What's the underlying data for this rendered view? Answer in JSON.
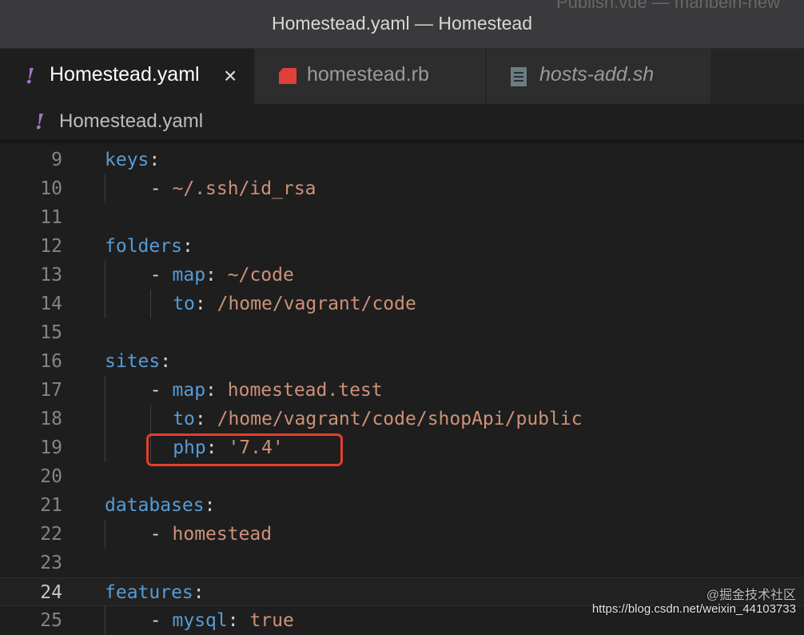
{
  "window": {
    "background_title": "Publish.vue — manbeln-new",
    "title": "Homestead.yaml — Homestead"
  },
  "tabs": [
    {
      "label": "Homestead.yaml",
      "icon": "yaml-icon",
      "active": true
    },
    {
      "label": "homestead.rb",
      "icon": "ruby-icon",
      "active": false
    },
    {
      "label": "hosts-add.sh",
      "icon": "shell-file-icon",
      "active": false
    }
  ],
  "breadcrumb": {
    "label": "Homestead.yaml",
    "icon": "yaml-icon"
  },
  "editor": {
    "current_line": "24",
    "lines": [
      {
        "n": "9",
        "k": "keys",
        "colon": ":",
        "dash": "",
        "val": ""
      },
      {
        "n": "10",
        "k": "",
        "colon": "",
        "dash": "- ",
        "val": "~/.ssh/id_rsa"
      },
      {
        "n": "11",
        "k": "",
        "colon": "",
        "dash": "",
        "val": ""
      },
      {
        "n": "12",
        "k": "folders",
        "colon": ":",
        "dash": "",
        "val": ""
      },
      {
        "n": "13",
        "k": "map",
        "colon": ": ",
        "dash": "- ",
        "val": "~/code"
      },
      {
        "n": "14",
        "k": "to",
        "colon": ": ",
        "dash": "",
        "val": "/home/vagrant/code"
      },
      {
        "n": "15",
        "k": "",
        "colon": "",
        "dash": "",
        "val": ""
      },
      {
        "n": "16",
        "k": "sites",
        "colon": ":",
        "dash": "",
        "val": ""
      },
      {
        "n": "17",
        "k": "map",
        "colon": ": ",
        "dash": "- ",
        "val": "homestead.test"
      },
      {
        "n": "18",
        "k": "to",
        "colon": ": ",
        "dash": "",
        "val": "/home/vagrant/code/shopApi/public"
      },
      {
        "n": "19",
        "k": "php",
        "colon": ": ",
        "dash": "",
        "val": "'7.4'"
      },
      {
        "n": "20",
        "k": "",
        "colon": "",
        "dash": "",
        "val": ""
      },
      {
        "n": "21",
        "k": "databases",
        "colon": ":",
        "dash": "",
        "val": ""
      },
      {
        "n": "22",
        "k": "",
        "colon": "",
        "dash": "- ",
        "val": "homestead"
      },
      {
        "n": "23",
        "k": "",
        "colon": "",
        "dash": "",
        "val": ""
      },
      {
        "n": "24",
        "k": "features",
        "colon": ":",
        "dash": "",
        "val": ""
      },
      {
        "n": "25",
        "k": "mysql",
        "colon": ": ",
        "dash": "- ",
        "val": "true"
      }
    ]
  },
  "colors": {
    "keyword": "#569cd6",
    "string": "#ce9178",
    "highlight_box": "#e53e2a",
    "yaml_icon": "#a074c4",
    "ruby_icon": "#e0403c"
  },
  "watermark": {
    "line1": "@掘金技术社区",
    "line2": "https://blog.csdn.net/weixin_44103733"
  }
}
